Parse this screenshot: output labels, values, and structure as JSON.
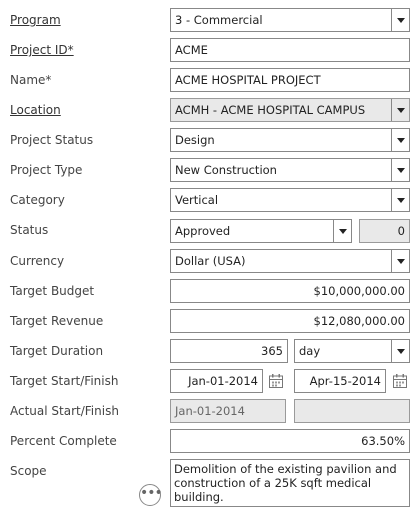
{
  "fields": {
    "program": {
      "label": "Program",
      "value": "3 - Commercial"
    },
    "project_id": {
      "label": "Project ID*",
      "value": "ACME"
    },
    "name": {
      "label": "Name*",
      "value": "ACME HOSPITAL PROJECT"
    },
    "location": {
      "label": "Location",
      "value": "ACMH - ACME HOSPITAL CAMPUS"
    },
    "project_status": {
      "label": "Project Status",
      "value": "Design"
    },
    "project_type": {
      "label": "Project Type",
      "value": "New Construction"
    },
    "category": {
      "label": "Category",
      "value": "Vertical"
    },
    "status": {
      "label": "Status",
      "value": "Approved",
      "count": "0"
    },
    "currency": {
      "label": "Currency",
      "value": "Dollar (USA)"
    },
    "target_budget": {
      "label": "Target Budget",
      "value": "$10,000,000.00"
    },
    "target_revenue": {
      "label": "Target Revenue",
      "value": "$12,080,000.00"
    },
    "target_duration": {
      "label": "Target Duration",
      "value": "365",
      "unit": "day"
    },
    "target_start_finish": {
      "label": "Target Start/Finish",
      "start": "Jan-01-2014",
      "finish": "Apr-15-2014"
    },
    "actual_start_finish": {
      "label": "Actual Start/Finish",
      "start": "Jan-01-2014",
      "finish": ""
    },
    "percent_complete": {
      "label": "Percent Complete",
      "value": "63.50%"
    },
    "scope": {
      "label": "Scope",
      "value": "Demolition of the existing pavilion and construction of a 25K sqft medical building."
    }
  },
  "icons": {
    "calendar": "calendar-icon",
    "more": "more-options-icon",
    "dropdown": "chevron-down-icon"
  }
}
